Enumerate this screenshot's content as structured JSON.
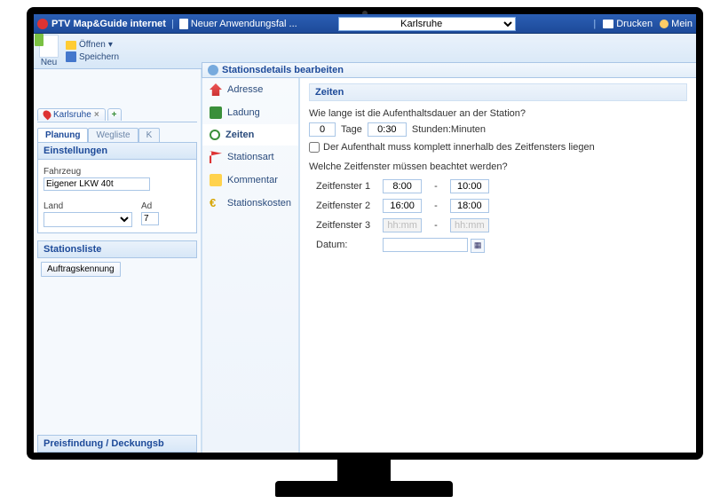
{
  "topbar": {
    "brand": "PTV Map&Guide internet",
    "doc_label": "Neuer Anwendungsfal ...",
    "search_value": "Karlsruhe",
    "print_label": "Drucken",
    "account_label": "Mein"
  },
  "toolbar": {
    "neu_label": "Neu",
    "open_label": "Öffnen",
    "save_label": "Speichern"
  },
  "station_header": "Stationsdetails bearbeiten",
  "left": {
    "chip_label": "Karlsruhe",
    "subtabs": {
      "planung": "Planung",
      "wegliste": "Wegliste",
      "k": "K"
    },
    "einstellungen_hdr": "Einstellungen",
    "fahrzeug_label": "Fahrzeug",
    "fahrzeug_value": "Eigener LKW 40t",
    "land_label": "Land",
    "land_value": "",
    "ad_label": "Ad",
    "ad_value": "7",
    "stationsliste_hdr": "Stationsliste",
    "auftrag_btn": "Auftragskennung",
    "footer_hdr": "Preisfindung / Deckungsb"
  },
  "midnav": {
    "adresse": "Adresse",
    "ladung": "Ladung",
    "zeiten": "Zeiten",
    "stationsart": "Stationsart",
    "kommentar": "Kommentar",
    "stationskosten": "Stationskosten"
  },
  "content": {
    "section_hdr": "Zeiten",
    "q_duration": "Wie lange ist die Aufenthaltsdauer an der Station?",
    "days_value": "0",
    "days_label": "Tage",
    "hours_value": "0:30",
    "hours_label": "Stunden:Minuten",
    "checkbox_label": "Der Aufenthalt muss komplett innerhalb des Zeitfensters liegen",
    "q_windows": "Welche Zeitfenster müssen beachtet werden?",
    "tw": [
      {
        "label": "Zeitfenster 1",
        "from": "8:00",
        "to": "10:00",
        "disabled": false
      },
      {
        "label": "Zeitfenster 2",
        "from": "16:00",
        "to": "18:00",
        "disabled": false
      },
      {
        "label": "Zeitfenster 3",
        "from": "hh:mm",
        "to": "hh:mm",
        "disabled": true
      }
    ],
    "datum_label": "Datum:",
    "datum_value": ""
  }
}
